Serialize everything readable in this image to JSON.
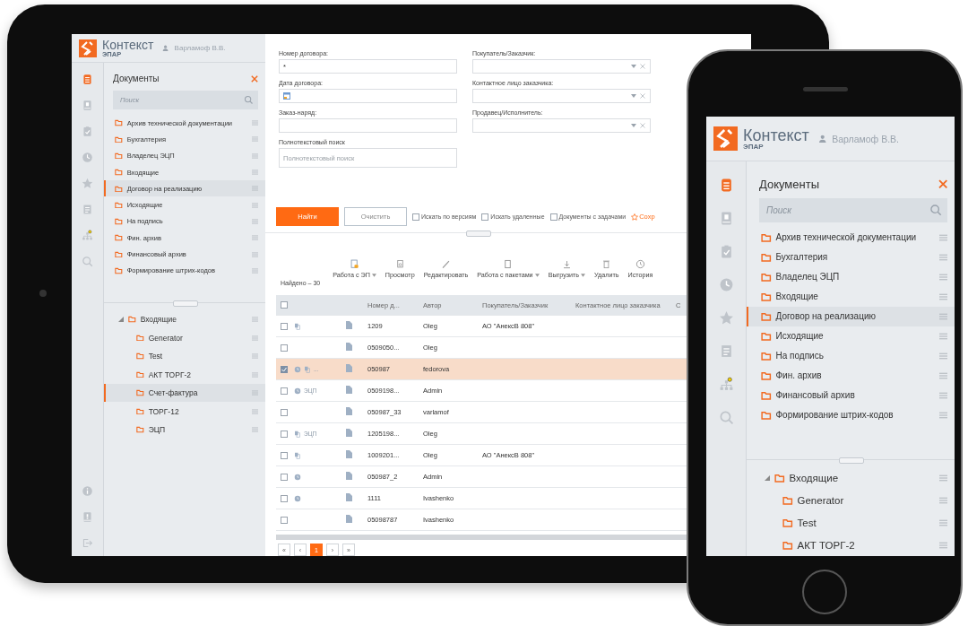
{
  "tablet": {
    "header": {
      "brand": "Контекст",
      "subtitle": "ЭПАР",
      "user": "Варламоф В.В."
    },
    "nav_rail": {
      "items": [
        {
          "kind": "documents",
          "selected": true
        },
        {
          "kind": "contacts",
          "selected": false
        },
        {
          "kind": "tasks",
          "selected": false
        },
        {
          "kind": "history",
          "selected": false
        },
        {
          "kind": "favorites",
          "selected": false
        },
        {
          "kind": "reports",
          "selected": false
        },
        {
          "kind": "structure",
          "selected": false
        },
        {
          "kind": "search",
          "selected": false
        }
      ],
      "bottom_items": [
        {
          "kind": "info",
          "selected": false
        },
        {
          "kind": "help",
          "selected": false
        },
        {
          "kind": "logout",
          "selected": false
        }
      ]
    },
    "documents_panel": {
      "title": "Документы",
      "search_placeholder": "Поиск",
      "folders": [
        {
          "label": "Архив технической документации",
          "selected": false
        },
        {
          "label": "Бухгалтерия",
          "selected": false
        },
        {
          "label": "Владелец ЭЦП",
          "selected": false
        },
        {
          "label": "Входящие",
          "selected": false
        },
        {
          "label": "Договор на реализацию",
          "selected": true
        },
        {
          "label": "Исходящие",
          "selected": false
        },
        {
          "label": "На подпись",
          "selected": false
        },
        {
          "label": "Фин. архив",
          "selected": false
        },
        {
          "label": "Финансовый архив",
          "selected": false
        },
        {
          "label": "Формирование штрих-кодов",
          "selected": false
        }
      ],
      "tree": [
        {
          "label": "Входящие",
          "expanded": true,
          "selected": false,
          "children": [
            {
              "label": "Generator",
              "selected": false
            },
            {
              "label": "Test",
              "selected": false
            },
            {
              "label": "АКТ ТОРГ-2",
              "selected": false
            },
            {
              "label": "Счет-фактура",
              "selected": true
            },
            {
              "label": "ТОРГ-12",
              "selected": false
            },
            {
              "label": "ЭЦП",
              "selected": false
            }
          ]
        }
      ]
    },
    "search_form": {
      "left_fields": [
        {
          "kind": "text",
          "label": "Номер договора:",
          "value": "*"
        },
        {
          "kind": "date",
          "label": "Дата договора:"
        },
        {
          "kind": "text",
          "label": "Заказ-наряд:"
        },
        {
          "kind": "fulltext",
          "label": "Полнотекстовый поиск",
          "placeholder": "Полнотекстовый поиск"
        }
      ],
      "right_fields": [
        {
          "kind": "select",
          "label": "Покупатель/Заказчик:"
        },
        {
          "kind": "select",
          "label": "Контактное лицо заказчика:"
        },
        {
          "kind": "select",
          "label": "Продавец/Исполнитель:"
        }
      ],
      "find_button": "Найти",
      "clear_button": "Очистить",
      "options": [
        {
          "label": "Искать по версиям",
          "checked": false
        },
        {
          "label": "Искать удаленные",
          "checked": false
        },
        {
          "label": "Документы с задачами",
          "checked": false
        }
      ],
      "save_link": "Сохр"
    },
    "results": {
      "found": "Найдено – 30",
      "toolbar": [
        {
          "kind": "sign",
          "label": "Работа с ЭП",
          "dropdown": true
        },
        {
          "kind": "view",
          "label": "Просмотр",
          "dropdown": false
        },
        {
          "kind": "edit",
          "label": "Редактировать",
          "dropdown": false
        },
        {
          "kind": "package",
          "label": "Работа с пакетами",
          "dropdown": true
        },
        {
          "kind": "download",
          "label": "Выгрузить",
          "dropdown": true
        },
        {
          "kind": "delete",
          "label": "Удалить",
          "dropdown": false
        },
        {
          "kind": "history",
          "label": "История",
          "dropdown": false
        }
      ],
      "select_all_checked": false,
      "columns": [
        "Номер д...",
        "Автор",
        "Покупатель/Заказчик",
        "Контактное лицо заказчика",
        "С"
      ],
      "rows": [
        {
          "checked": false,
          "selected": false,
          "clock": false,
          "copy": true,
          "number": "1209",
          "author": "Oleg",
          "buyer": "АО \"АнексВ 808\""
        },
        {
          "checked": false,
          "selected": false,
          "clock": false,
          "copy": false,
          "number": "0509050...",
          "author": "Oleg"
        },
        {
          "checked": true,
          "selected": true,
          "clock": true,
          "copy": true,
          "tag": "...",
          "number": "050987",
          "author": "fedorova"
        },
        {
          "checked": false,
          "selected": false,
          "clock": true,
          "copy": false,
          "tag": "ЭЦП",
          "number": "0509198...",
          "author": "Admin"
        },
        {
          "checked": false,
          "selected": false,
          "clock": false,
          "copy": false,
          "number": "050987_33",
          "author": "varlamof"
        },
        {
          "checked": false,
          "selected": false,
          "clock": false,
          "copy": true,
          "tag": "ЭЦП",
          "number": "1205198...",
          "author": "Oleg"
        },
        {
          "checked": false,
          "selected": false,
          "clock": false,
          "copy": true,
          "number": "1009201...",
          "author": "Oleg",
          "buyer": "АО \"АнексВ 808\""
        },
        {
          "checked": false,
          "selected": false,
          "clock": true,
          "copy": false,
          "number": "050987_2",
          "author": "Admin"
        },
        {
          "checked": false,
          "selected": false,
          "clock": true,
          "copy": false,
          "number": "1111",
          "author": "Ivashenko"
        },
        {
          "checked": false,
          "selected": false,
          "clock": false,
          "copy": false,
          "number": "05098787",
          "author": "Ivashenko"
        }
      ],
      "pagination": [
        {
          "label": "«",
          "selected": false
        },
        {
          "label": "‹",
          "selected": false
        },
        {
          "label": "1",
          "selected": true
        },
        {
          "label": "›",
          "selected": false
        },
        {
          "label": "»",
          "selected": false
        }
      ]
    }
  },
  "phone": {
    "header": {
      "brand": "Контекст",
      "subtitle": "ЭПАР",
      "user": "Варламоф В.В."
    },
    "nav_rail": {
      "items": [
        {
          "kind": "documents",
          "selected": true
        },
        {
          "kind": "contacts",
          "selected": false
        },
        {
          "kind": "tasks",
          "selected": false
        },
        {
          "kind": "history",
          "selected": false
        },
        {
          "kind": "favorites",
          "selected": false
        },
        {
          "kind": "reports",
          "selected": false
        },
        {
          "kind": "structure",
          "selected": false
        },
        {
          "kind": "search",
          "selected": false
        }
      ]
    },
    "documents_panel": {
      "title": "Документы",
      "search_placeholder": "Поиск",
      "folders": [
        {
          "label": "Архив технической документации",
          "selected": false
        },
        {
          "label": "Бухгалтерия",
          "selected": false
        },
        {
          "label": "Владелец ЭЦП",
          "selected": false
        },
        {
          "label": "Входящие",
          "selected": false
        },
        {
          "label": "Договор на реализацию",
          "selected": true
        },
        {
          "label": "Исходящие",
          "selected": false
        },
        {
          "label": "На подпись",
          "selected": false
        },
        {
          "label": "Фин. архив",
          "selected": false
        },
        {
          "label": "Финансовый архив",
          "selected": false
        },
        {
          "label": "Формирование штрих-кодов",
          "selected": false
        }
      ],
      "tree": [
        {
          "label": "Входящие",
          "expanded": true,
          "selected": false,
          "children": [
            {
              "label": "Generator",
              "selected": false
            },
            {
              "label": "Test",
              "selected": false
            },
            {
              "label": "АКТ ТОРГ-2",
              "selected": false
            }
          ]
        }
      ]
    }
  }
}
